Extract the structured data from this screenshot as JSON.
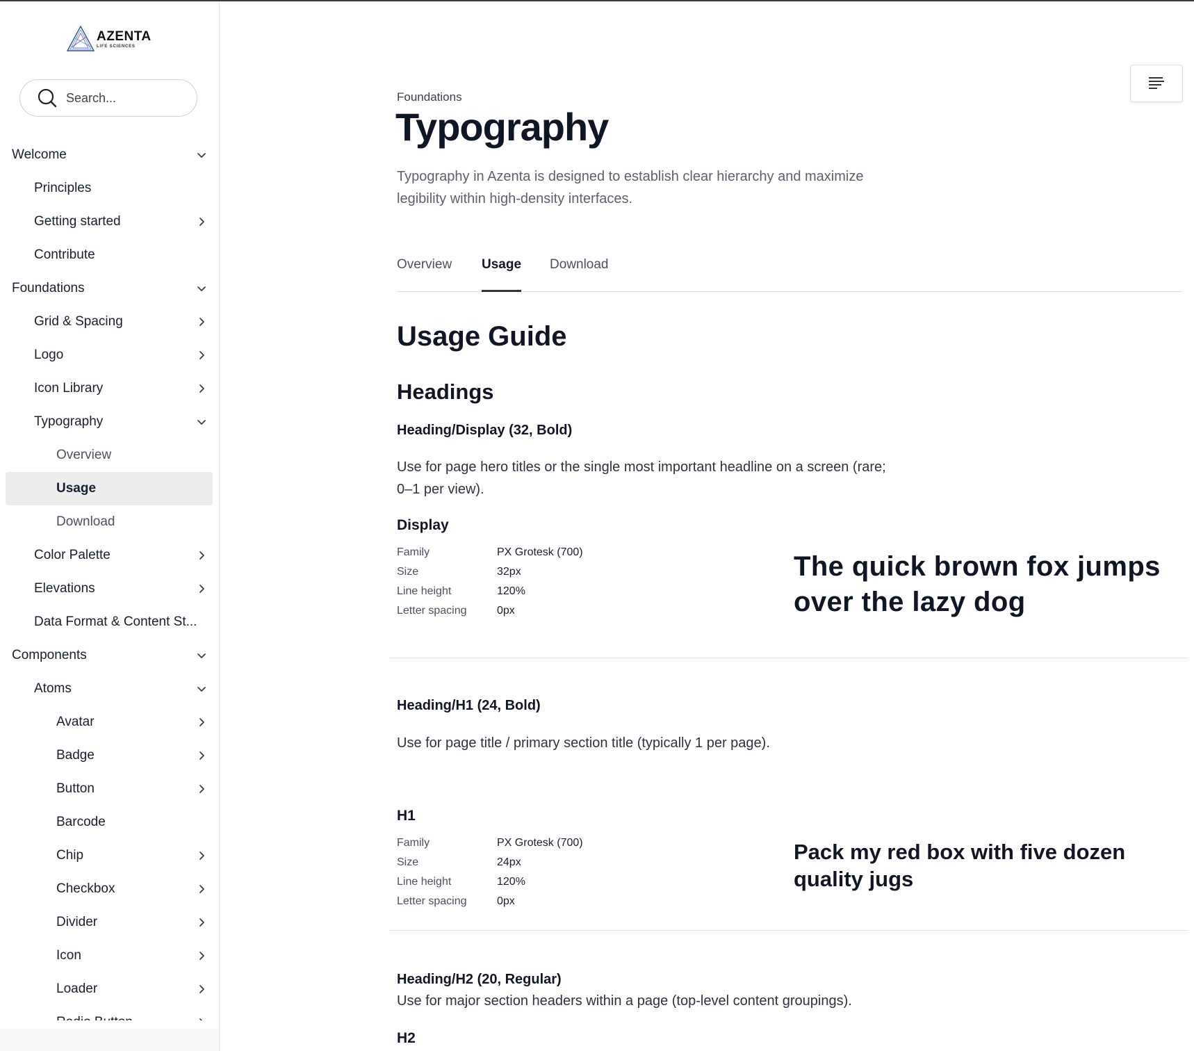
{
  "brand": {
    "name": "AZENTA",
    "tagline": "LIFE SCIENCES"
  },
  "search": {
    "placeholder": "Search..."
  },
  "sidebar": {
    "items": [
      {
        "label": "Welcome",
        "level": 0,
        "chevron": "down"
      },
      {
        "label": "Principles",
        "level": 1,
        "chevron": ""
      },
      {
        "label": "Getting started",
        "level": 1,
        "chevron": "right"
      },
      {
        "label": "Contribute",
        "level": 1,
        "chevron": ""
      },
      {
        "label": "Foundations",
        "level": 0,
        "chevron": "down"
      },
      {
        "label": "Grid & Spacing",
        "level": 1,
        "chevron": "right"
      },
      {
        "label": "Logo",
        "level": 1,
        "chevron": "right"
      },
      {
        "label": "Icon Library",
        "level": 1,
        "chevron": "right"
      },
      {
        "label": "Typography",
        "level": 1,
        "chevron": "down"
      },
      {
        "label": "Overview",
        "level": 2,
        "chevron": "",
        "style": "sub"
      },
      {
        "label": "Usage",
        "level": 2,
        "chevron": "",
        "style": "active"
      },
      {
        "label": "Download",
        "level": 2,
        "chevron": "",
        "style": "sub"
      },
      {
        "label": "Color Palette",
        "level": 1,
        "chevron": "right"
      },
      {
        "label": "Elevations",
        "level": 1,
        "chevron": "right"
      },
      {
        "label": "Data Format & Content St...",
        "level": 1,
        "chevron": ""
      },
      {
        "label": "Components",
        "level": 0,
        "chevron": "down"
      },
      {
        "label": "Atoms",
        "level": 1,
        "chevron": "down"
      },
      {
        "label": "Avatar",
        "level": 2,
        "chevron": "right"
      },
      {
        "label": "Badge",
        "level": 2,
        "chevron": "right"
      },
      {
        "label": "Button",
        "level": 2,
        "chevron": "right"
      },
      {
        "label": "Barcode",
        "level": 2,
        "chevron": ""
      },
      {
        "label": "Chip",
        "level": 2,
        "chevron": "right"
      },
      {
        "label": "Checkbox",
        "level": 2,
        "chevron": "right"
      },
      {
        "label": "Divider",
        "level": 2,
        "chevron": "right"
      },
      {
        "label": "Icon",
        "level": 2,
        "chevron": "right"
      },
      {
        "label": "Loader",
        "level": 2,
        "chevron": "right"
      },
      {
        "label": "Radio Button",
        "level": 2,
        "chevron": "right"
      }
    ]
  },
  "page": {
    "breadcrumb": "Foundations",
    "title": "Typography",
    "intro": "Typography in Azenta is designed to establish clear hierarchy and maximize legibility within high-density interfaces.",
    "tabs": [
      "Overview",
      "Usage",
      "Download"
    ],
    "active_tab": "Usage"
  },
  "content": {
    "guide_title": "Usage Guide",
    "headings_title": "Headings",
    "display": {
      "heading": "Heading/Display (32, Bold)",
      "desc": "Use for page hero titles or the single most important headline on a screen (rare; 0–1 per view).",
      "name": "Display",
      "spec": [
        {
          "key": "Family",
          "value": "PX Grotesk (700)"
        },
        {
          "key": "Size",
          "value": "32px"
        },
        {
          "key": "Line height",
          "value": "120%"
        },
        {
          "key": "Letter spacing",
          "value": "0px"
        }
      ],
      "sample": "The quick brown fox jumps over the lazy dog"
    },
    "h1": {
      "heading": "Heading/H1 (24, Bold)",
      "desc": "Use for page title / primary section title (typically 1 per page).",
      "name": "H1",
      "spec": [
        {
          "key": "Family",
          "value": "PX Grotesk (700)"
        },
        {
          "key": "Size",
          "value": "24px"
        },
        {
          "key": "Line height",
          "value": "120%"
        },
        {
          "key": "Letter spacing",
          "value": "0px"
        }
      ],
      "sample": "Pack my red box with five dozen quality jugs"
    },
    "h2": {
      "heading": "Heading/H2 (20, Regular)",
      "desc": "Use for major section headers within a page (top-level content groupings).",
      "name": "H2"
    }
  },
  "colors": {
    "text": "#0f1726",
    "muted": "#5a6270",
    "active_bg": "#ededed",
    "border": "#e3e3e3"
  }
}
